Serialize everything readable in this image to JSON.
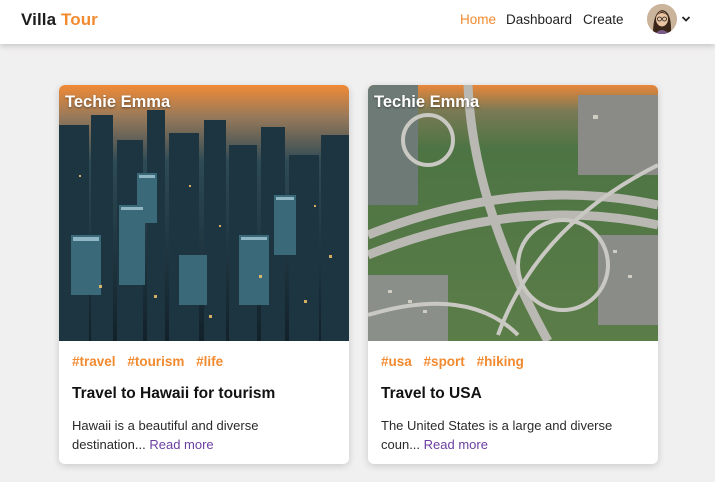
{
  "navbar": {
    "brand_main": "Villa",
    "brand_accent": "Tour",
    "links": [
      "Home",
      "Dashboard",
      "Create"
    ],
    "active_link": "Home",
    "avatar_icon": "user-avatar",
    "dropdown_icon": "chevron-down-icon"
  },
  "colors": {
    "accent": "#f28a30",
    "background": "#f1f0f0",
    "link": "#6b3fa0"
  },
  "cards": [
    {
      "author": "Techie Emma",
      "image_icon": "city-skyline-photo",
      "tags": [
        "#travel",
        "#tourism",
        "#life"
      ],
      "title": "Travel to Hawaii for tourism",
      "excerpt": "Hawaii is a beautiful and diverse destination...",
      "read_more": "Read more"
    },
    {
      "author": "Techie Emma",
      "image_icon": "highway-interchange-photo",
      "tags": [
        "#usa",
        "#sport",
        "#hiking"
      ],
      "title": "Travel to USA",
      "excerpt": "The United States is a large and diverse coun...",
      "read_more": "Read more"
    }
  ]
}
